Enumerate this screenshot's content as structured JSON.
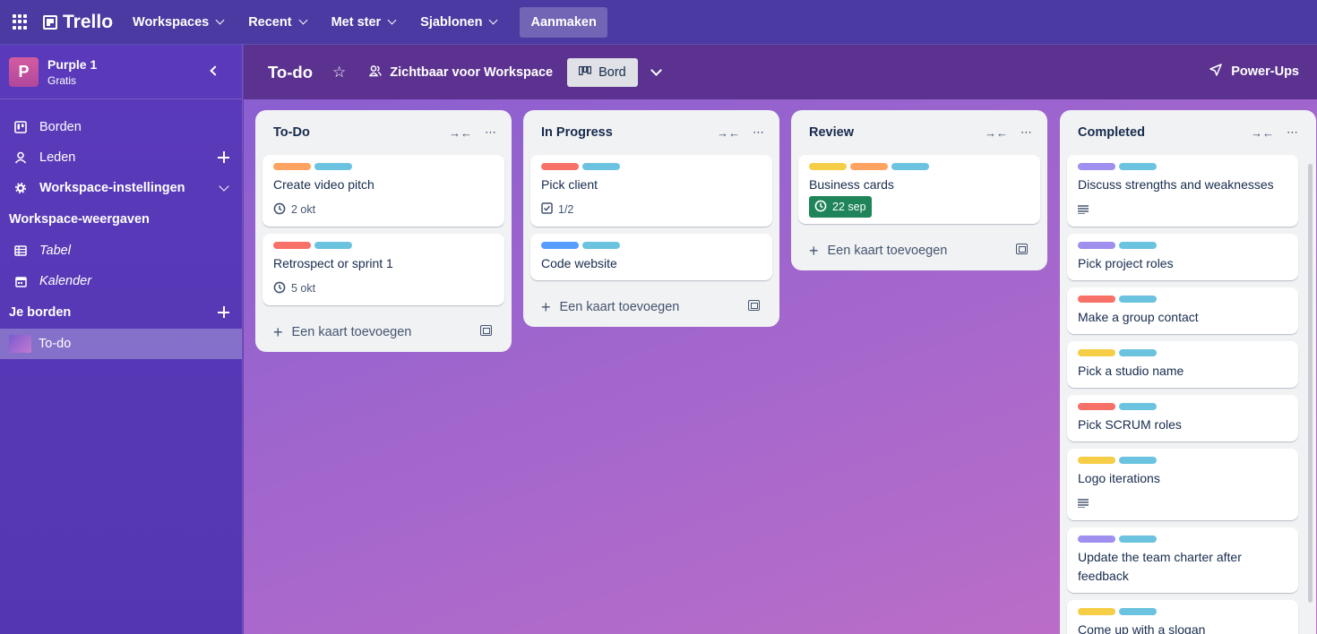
{
  "topnav": {
    "brand": "Trello",
    "items": [
      {
        "label": "Workspaces"
      },
      {
        "label": "Recent"
      },
      {
        "label": "Met ster"
      },
      {
        "label": "Sjablonen"
      }
    ],
    "create_label": "Aanmaken"
  },
  "sidebar": {
    "workspace": {
      "initial": "P",
      "name": "Purple 1",
      "plan": "Gratis"
    },
    "items": [
      {
        "label": "Borden",
        "icon": "board-icon"
      },
      {
        "label": "Leden",
        "icon": "person-icon"
      },
      {
        "label": "Workspace-instellingen",
        "icon": "gear-icon"
      }
    ],
    "views_title": "Workspace-weergaven",
    "views": [
      {
        "label": "Tabel",
        "icon": "table-icon"
      },
      {
        "label": "Kalender",
        "icon": "calendar-icon"
      }
    ],
    "boards_title": "Je borden",
    "boards": [
      {
        "label": "To-do"
      }
    ]
  },
  "board": {
    "title": "To-do",
    "visibility": "Zichtbaar voor Workspace",
    "view_label": "Bord",
    "powerups": "Power-Ups",
    "add_card_label": "Een kaart toevoegen"
  },
  "colors": {
    "orange": "#fea362",
    "sky": "#6cc3e0",
    "red": "#f87168",
    "blue": "#579dff",
    "yellow": "#f5cd47",
    "purple": "#9f8fef",
    "due_green": "#1f845a"
  },
  "lists": [
    {
      "title": "To-Do",
      "cards": [
        {
          "title": "Create video pitch",
          "labels": [
            "orange",
            "sky"
          ],
          "badge": "2 okt"
        },
        {
          "title": "Retrospect or sprint 1",
          "labels": [
            "red",
            "sky"
          ],
          "badge": "5 okt"
        }
      ]
    },
    {
      "title": "In Progress",
      "cards": [
        {
          "title": "Pick client",
          "labels": [
            "red",
            "sky"
          ],
          "badge": "1/2"
        },
        {
          "title": "Code website",
          "labels": [
            "blue",
            "sky"
          ]
        }
      ]
    },
    {
      "title": "Review",
      "cards": [
        {
          "title": "Business cards",
          "labels": [
            "yellow",
            "orange",
            "sky"
          ],
          "badge": "22 sep"
        }
      ]
    },
    {
      "title": "Completed",
      "cards": [
        {
          "title": "Discuss strengths and weaknesses",
          "labels": [
            "purple",
            "sky"
          ],
          "description": true
        },
        {
          "title": "Pick project roles",
          "labels": [
            "purple",
            "sky"
          ]
        },
        {
          "title": "Make a group contact",
          "labels": [
            "red",
            "sky"
          ]
        },
        {
          "title": "Pick a studio name",
          "labels": [
            "yellow",
            "sky"
          ]
        },
        {
          "title": "Pick SCRUM roles",
          "labels": [
            "red",
            "sky"
          ]
        },
        {
          "title": "Logo iterations",
          "labels": [
            "yellow",
            "sky"
          ],
          "description": true
        },
        {
          "title": "Update the team charter after feedback",
          "labels": [
            "purple",
            "sky"
          ]
        },
        {
          "title": "Come up with a slogan",
          "labels": [
            "yellow",
            "sky"
          ]
        }
      ]
    }
  ]
}
